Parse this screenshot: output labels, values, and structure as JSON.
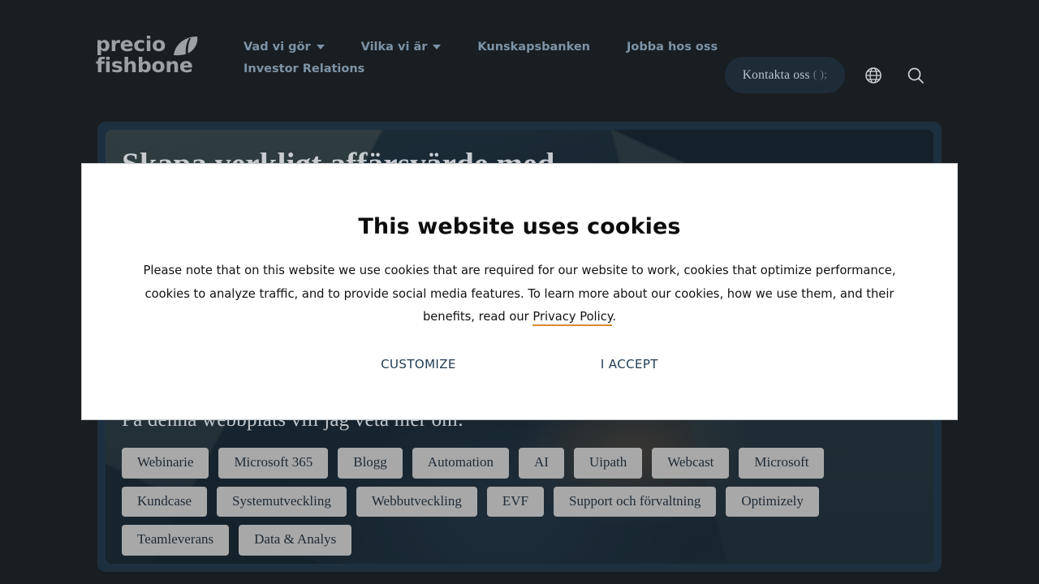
{
  "header": {
    "logo": {
      "line1": "precio",
      "line2": "fishbone",
      "icon": "swoosh-logo-icon"
    },
    "nav": {
      "row1": [
        {
          "label": "Vad vi gör",
          "has_dropdown": true
        },
        {
          "label": "Vilka vi är",
          "has_dropdown": true
        },
        {
          "label": "Kunskapsbanken",
          "has_dropdown": false
        },
        {
          "label": "Jobba hos oss",
          "has_dropdown": false
        }
      ],
      "row2": [
        {
          "label": "Investor Relations",
          "has_dropdown": false
        }
      ]
    },
    "contact_button": {
      "label": "Kontakta oss",
      "suffix": "( );"
    },
    "icons": {
      "language": "globe-icon",
      "search": "search-icon"
    }
  },
  "hero": {
    "title": "Skapa verkligt affärsvärde med",
    "subtitle": "På denna webbplats vill jag veta mer om:",
    "tags": [
      "Webinarie",
      "Microsoft 365",
      "Blogg",
      "Automation",
      "AI",
      "Uipath",
      "Webcast",
      "Microsoft",
      "Kundcase",
      "Systemutveckling",
      "Webbutveckling",
      "EVF",
      "Support och förvaltning",
      "Optimizely",
      "Teamleverans",
      "Data & Analys"
    ]
  },
  "cookie_dialog": {
    "title": "This website uses cookies",
    "body_part1": "Please note that on this website we use cookies that are required for our website to work, cookies that optimize performance, cookies to analyze traffic, and to provide social media features. To learn more about our cookies, how we use them, and their benefits, read our ",
    "link_label": "Privacy Policy",
    "body_part2": ".",
    "customize_label": "CUSTOMIZE",
    "accept_label": "I ACCEPT"
  },
  "colors": {
    "page_background": "#191e22",
    "hero_panel": "#1d3040",
    "tag_background": "#a8a8a8",
    "tag_text": "#1e2a35",
    "nav_text": "#7d93a6",
    "dialog_background": "#ffffff",
    "link_underline": "#d98b2b",
    "dialog_button_text": "#1e3a52"
  }
}
